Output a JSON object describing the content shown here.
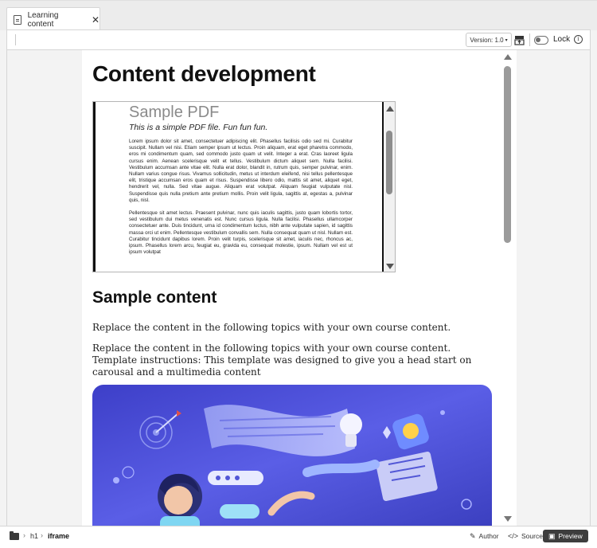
{
  "tab": {
    "label": "Learning content",
    "close": "✕"
  },
  "toolbar": {
    "version_label": "Version: 1.0",
    "lock_label": "Lock",
    "info_glyph": "i"
  },
  "page": {
    "title": "Content development",
    "pdf": {
      "title": "Sample PDF",
      "subtitle": "This is a simple PDF file. Fun fun fun.",
      "paragraph1": "Lorem ipsum dolor sit amet, consectetuer adipiscing elit. Phasellus facilisis odio sed mi. Curabitur suscipit. Nullam vel nisi. Etiam semper ipsum ut lectus. Proin aliquam, erat eget pharetra commodo, eros mi condimentum quam, sed commodo justo quam ut velit. Integer a erat. Cras laoreet ligula cursus enim. Aenean scelerisque velit et tellus. Vestibulum dictum aliquet sem. Nulla facilisi. Vestibulum accumsan ante vitae elit. Nulla erat dolor, blandit in, rutrum quis, semper pulvinar, enim. Nullam varius congue risus. Vivamus sollicitudin, metus ut interdum eleifend, nisi tellus pellentesque elit, tristique accumsan eros quam et risus. Suspendisse libero odio, mattis sit amet, aliquet eget, hendrerit vel, nulla. Sed vitae augue. Aliquam erat volutpat. Aliquam feugiat vulputate nisl. Suspendisse quis nulla pretium ante pretium mollis. Proin velit ligula, sagittis at, egestas a, pulvinar quis, nisl.",
      "paragraph2": "Pellentesque sit amet lectus. Praesent pulvinar, nunc quis iaculis sagittis, justo quam lobortis tortor, sed vestibulum dui metus venenatis est. Nunc cursus ligula. Nulla facilisi. Phasellus ullamcorper consectetuer ante. Duis tincidunt, urna id condimentum luctus, nibh ante vulputate sapien, id sagittis massa orci ut enim. Pellentesque vestibulum convallis sem. Nulla consequat quam ut nisl. Nullam est. Curabitur tincidunt dapibus lorem. Proin velit turpis, scelerisque sit amet, iaculis nec, rhoncus ac, ipsum. Phasellus lorem arcu, feugiat eu, gravida eu, consequat molestie, ipsum. Nullam vel est ut ipsum volutpat"
    },
    "section_heading": "Sample content",
    "body1": "Replace the content in the following topics with your own course content.",
    "body2": "Replace the content in the following topics with your own course content. Template instructions: This template was designed to give you a head start on carousal and a multimedia content"
  },
  "statusbar": {
    "breadcrumb": [
      "h1",
      "iframe"
    ],
    "author_label": "Author",
    "source_label": "Source",
    "preview_label": "Preview"
  },
  "colors": {
    "accent_dark": "#3d3d3d",
    "illustration_blue": "#4b4fd8"
  }
}
